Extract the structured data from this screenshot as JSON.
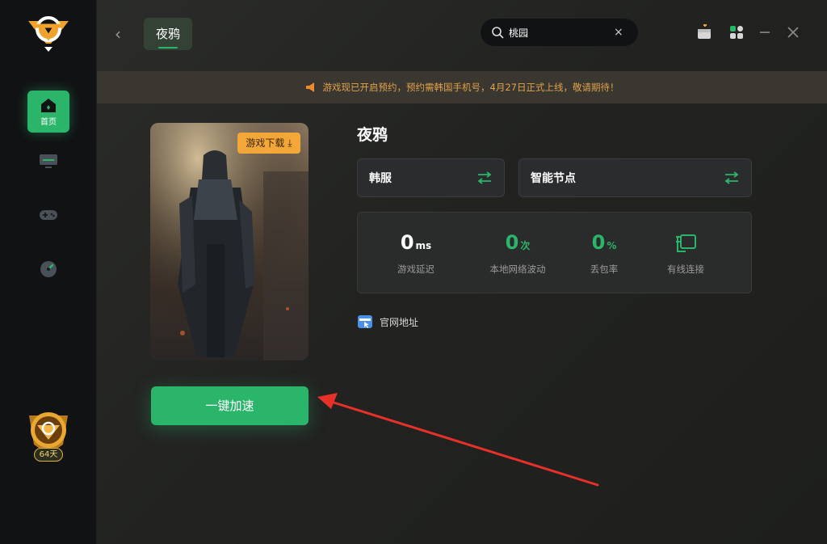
{
  "header": {
    "tab_label": "夜鸦",
    "search_value": "桃园",
    "search_clear": "×"
  },
  "sidebar": {
    "items": [
      {
        "label": "首页",
        "icon": "home-icon",
        "active": true
      },
      {
        "label": "",
        "icon": "monitor-icon",
        "active": false
      },
      {
        "label": "",
        "icon": "gamepad-icon",
        "active": false
      },
      {
        "label": "",
        "icon": "speedometer-icon",
        "active": false
      }
    ],
    "badge_days": "64天"
  },
  "notice": {
    "text": "游戏现已开启预约，预约需韩国手机号，4月27日正式上线，敬请期待！"
  },
  "game": {
    "title": "夜鸦",
    "download_label": "游戏下载",
    "region_label": "韩服",
    "node_label": "智能节点",
    "accelerate_label": "一键加速",
    "website_label": "官网地址"
  },
  "stats": {
    "latency": {
      "value": "0",
      "unit": "ms",
      "caption": "游戏延迟"
    },
    "jitter": {
      "value": "0",
      "unit": "次",
      "caption": "本地网络波动"
    },
    "loss": {
      "value": "0",
      "unit": "%",
      "caption": "丢包率"
    },
    "connection": {
      "caption": "有线连接"
    }
  },
  "colors": {
    "accent": "#2ab56a",
    "download": "#f3a738",
    "notice_text": "#e0a24a",
    "annotation_arrow": "#e8302a"
  }
}
